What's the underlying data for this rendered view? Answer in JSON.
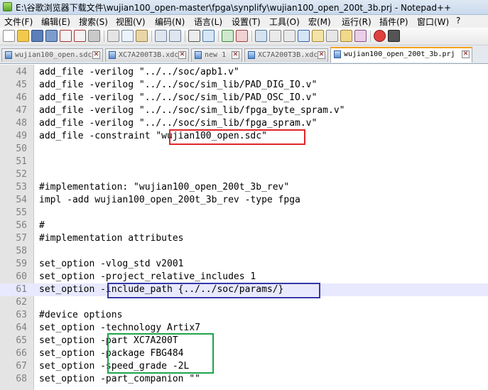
{
  "window": {
    "title": "E:\\谷歌浏览器下载文件\\wujian100_open-master\\fpga\\synplify\\wujian100_open_200t_3b.prj - Notepad++"
  },
  "menu": [
    "文件(F)",
    "编辑(E)",
    "搜索(S)",
    "视图(V)",
    "编码(N)",
    "语言(L)",
    "设置(T)",
    "工具(O)",
    "宏(M)",
    "运行(R)",
    "插件(P)",
    "窗口(W)",
    "?"
  ],
  "toolbar": {
    "buttons": [
      "new-file-icon",
      "open-file-icon",
      "save-icon",
      "save-all-icon",
      "close-icon",
      "close-all-icon",
      "print-icon",
      "cut-icon",
      "copy-icon",
      "paste-icon",
      "undo-icon",
      "redo-icon",
      "find-icon",
      "replace-icon",
      "zoom-in-icon",
      "zoom-out-icon",
      "sync-scroll-icon",
      "wrap-icon",
      "show-all-chars-icon",
      "indent-guide-icon",
      "doc-map-icon",
      "function-list-icon",
      "folder-workspace-icon",
      "monitor-icon",
      "record-macro-icon",
      "stop-record-icon"
    ]
  },
  "tabs": [
    {
      "label": "wujian100_open.sdc",
      "active": false
    },
    {
      "label": "XC7A200T3B.xdc",
      "active": false
    },
    {
      "label": "new 1",
      "active": false
    },
    {
      "label": "XC7A200T3B.xdc",
      "active": false
    },
    {
      "label": "wujian100_open_200t_3b.prj",
      "active": true
    }
  ],
  "editor": {
    "lines": [
      {
        "no": "44",
        "text": "add_file -verilog \"../../soc/apb1.v\""
      },
      {
        "no": "45",
        "text": "add_file -verilog \"../../soc/sim_lib/PAD_DIG_IO.v\""
      },
      {
        "no": "46",
        "text": "add_file -verilog \"../../soc/sim_lib/PAD_OSC_IO.v\""
      },
      {
        "no": "47",
        "text": "add_file -verilog \"../../soc/sim_lib/fpga_byte_spram.v\""
      },
      {
        "no": "48",
        "text": "add_file -verilog \"../../soc/sim_lib/fpga_spram.v\""
      },
      {
        "no": "49",
        "text": "add_file -constraint \"wujian100_open.sdc\""
      },
      {
        "no": "50",
        "text": ""
      },
      {
        "no": "51",
        "text": ""
      },
      {
        "no": "52",
        "text": ""
      },
      {
        "no": "53",
        "text": "#implementation: \"wujian100_open_200t_3b_rev\""
      },
      {
        "no": "54",
        "text": "impl -add wujian100_open_200t_3b_rev -type fpga"
      },
      {
        "no": "55",
        "text": ""
      },
      {
        "no": "56",
        "text": "#"
      },
      {
        "no": "57",
        "text": "#implementation attributes"
      },
      {
        "no": "58",
        "text": ""
      },
      {
        "no": "59",
        "text": "set_option -vlog_std v2001"
      },
      {
        "no": "60",
        "text": "set_option -project_relative_includes 1"
      },
      {
        "no": "61",
        "text": "set_option -include_path {../../soc/params/}"
      },
      {
        "no": "62",
        "text": ""
      },
      {
        "no": "63",
        "text": "#device options"
      },
      {
        "no": "64",
        "text": "set_option -technology Artix7"
      },
      {
        "no": "65",
        "text": "set_option -part XC7A200T"
      },
      {
        "no": "66",
        "text": "set_option -package FBG484"
      },
      {
        "no": "67",
        "text": "set_option -speed_grade -2L"
      },
      {
        "no": "68",
        "text": "set_option -part_companion \"\""
      }
    ],
    "current_line": "61"
  },
  "highlight_colors": {
    "red": "#e0262a",
    "blue": "#3438a8",
    "green": "#1ea54a"
  }
}
